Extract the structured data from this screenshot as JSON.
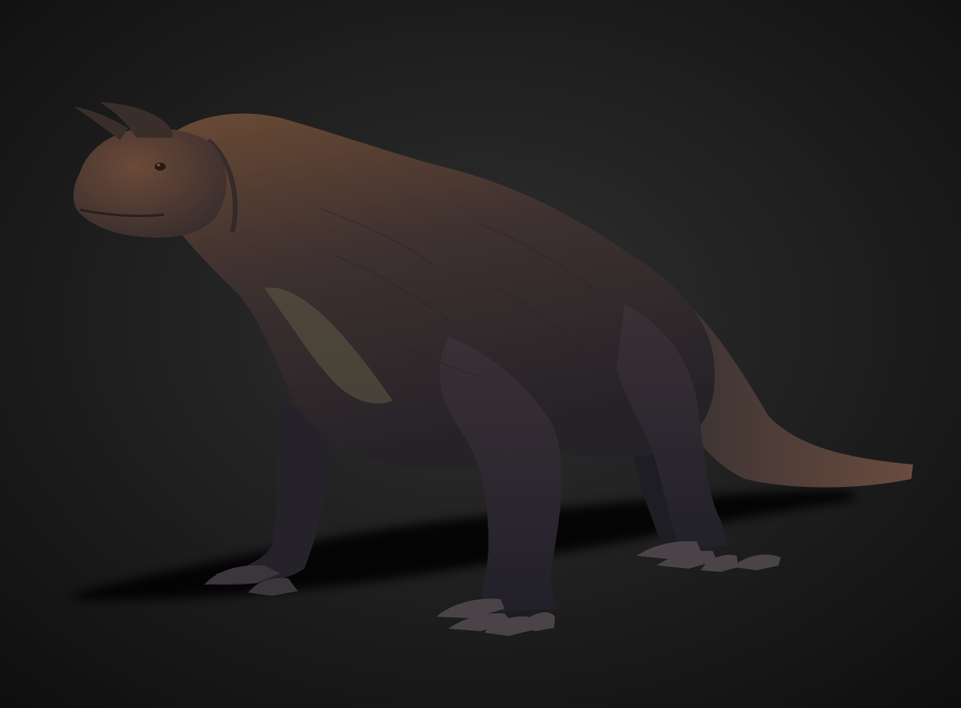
{
  "scene": {
    "subject": "horned-quadruped-reptile-3d-render",
    "colors": {
      "background_center": "#303030",
      "background_edge": "#0e0e0e",
      "skin_light": "#6a4a34",
      "skin_mid": "#3e3130",
      "skin_dark": "#252228",
      "belly": "#5e5a44",
      "horn": "#3a2e2a",
      "claw": "#4a4448",
      "shadow": "#050505"
    }
  }
}
